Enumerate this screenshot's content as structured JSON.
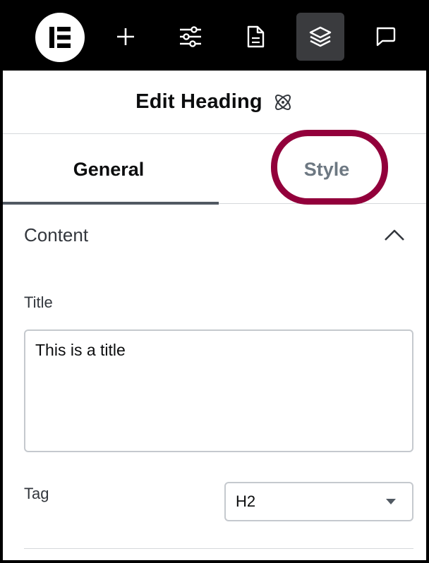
{
  "toolbar": {
    "items": [
      {
        "icon": "elementor-logo-icon"
      },
      {
        "icon": "plus-icon"
      },
      {
        "icon": "sliders-icon"
      },
      {
        "icon": "document-icon"
      },
      {
        "icon": "layers-icon",
        "active": true
      },
      {
        "icon": "chat-bubble-icon"
      }
    ]
  },
  "header": {
    "title": "Edit Heading",
    "icon": "atom-icon"
  },
  "tabs": [
    {
      "label": "General",
      "active": true
    },
    {
      "label": "Style",
      "highlighted": true
    }
  ],
  "section": {
    "title": "Content",
    "collapse_icon": "chevron-up-icon"
  },
  "fields": {
    "title_label": "Title",
    "title_value": "This is a title",
    "tag_label": "Tag",
    "tag_value": "H2"
  },
  "colors": {
    "highlight": "#92003b",
    "toolbar_bg": "#000000",
    "active_button_bg": "#3a3b3e"
  }
}
